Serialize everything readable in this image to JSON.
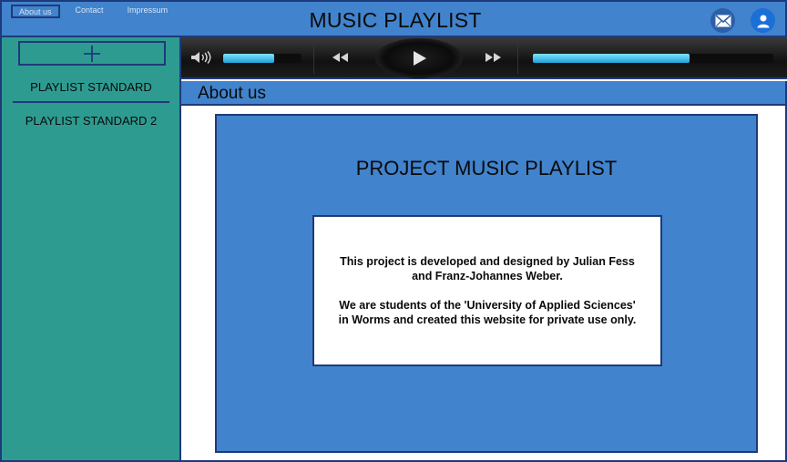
{
  "topnav": {
    "items": [
      {
        "label": "About us",
        "active": true
      },
      {
        "label": "Contact",
        "active": false
      },
      {
        "label": "Impressum",
        "active": false
      }
    ]
  },
  "header": {
    "title": "MUSIC PLAYLIST",
    "icons": [
      "mail-icon",
      "user-icon"
    ]
  },
  "sidebar": {
    "add_icon": "plus-icon",
    "playlists": [
      "PLAYLIST STANDARD",
      "PLAYLIST STANDARD 2"
    ]
  },
  "player": {
    "volume_level": 0.65,
    "progress": 0.65,
    "controls": [
      "volume-icon",
      "rewind-icon",
      "play-icon",
      "fast-forward-icon"
    ]
  },
  "page": {
    "heading": "About us"
  },
  "about": {
    "title": "PROJECT MUSIC PLAYLIST",
    "paragraph1": "This project is developed and designed by Julian Fess and Franz-Johannes Weber.",
    "paragraph2": "We are students of the 'University of Applied Sciences' in Worms and created this website for private use only."
  },
  "colors": {
    "header_bg": "#4183cc",
    "sidebar_bg": "#2e9b91",
    "border": "#1f3a7a",
    "accent_fill": "#1ea2d8"
  }
}
